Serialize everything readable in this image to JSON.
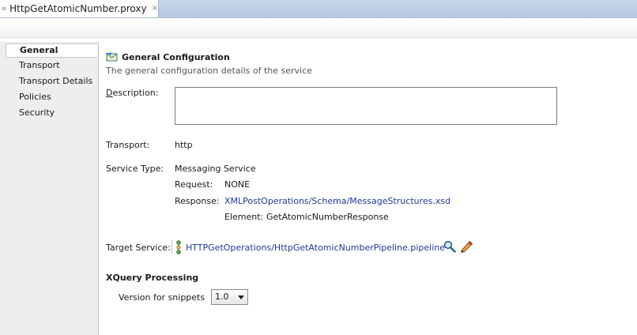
{
  "tab": {
    "title": "HttpGetAtomicNumber.proxy",
    "close": "×"
  },
  "nav": {
    "items": [
      {
        "label": "General",
        "selected": true
      },
      {
        "label": "Transport"
      },
      {
        "label": "Transport Details"
      },
      {
        "label": "Policies"
      },
      {
        "label": "Security"
      }
    ]
  },
  "section": {
    "title": "General Configuration",
    "description": "The general configuration details of the service"
  },
  "form": {
    "description_label_first": "D",
    "description_label_rest": "escription:",
    "description_value": "",
    "transport_label": "Transport:",
    "transport_value": "http",
    "service_type_label": "Service Type:",
    "service_type_value": "Messaging Service",
    "request_label": "Request:",
    "request_value": "NONE",
    "response_label": "Response:",
    "response_value": "XMLPostOperations/Schema/MessageStructures.xsd",
    "element_label": "Element:",
    "element_value": "GetAtomicNumberResponse",
    "target_service_label": "Target Service:",
    "target_service_value": "HTTPGetOperations/HttpGetAtomicNumberPipeline.pipeline"
  },
  "xquery": {
    "heading": "XQuery Processing",
    "version_label": "Version for snippets",
    "version_value": "1.0"
  },
  "icons": {
    "tab": "proxy-service-icon",
    "section": "proxy-service-icon",
    "pipeline": "pipeline-icon",
    "browse": "magnifier-icon",
    "edit": "pencil-icon"
  },
  "colors": {
    "link": "#1b3b9c",
    "tabbar": "#c6d4e8",
    "nav_bg": "#eeeeee"
  }
}
